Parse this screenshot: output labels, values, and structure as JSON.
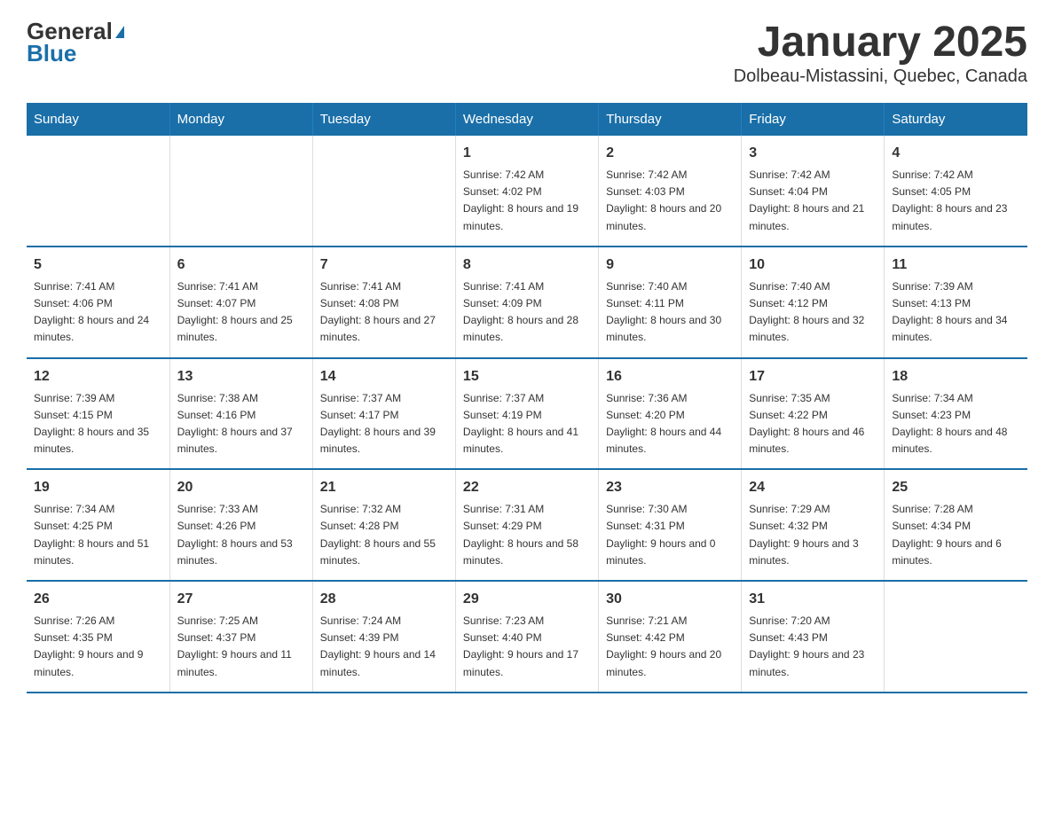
{
  "logo": {
    "general": "General",
    "blue": "Blue"
  },
  "title": "January 2025",
  "subtitle": "Dolbeau-Mistassini, Quebec, Canada",
  "headers": [
    "Sunday",
    "Monday",
    "Tuesday",
    "Wednesday",
    "Thursday",
    "Friday",
    "Saturday"
  ],
  "weeks": [
    [
      {
        "day": "",
        "sunrise": "",
        "sunset": "",
        "daylight": ""
      },
      {
        "day": "",
        "sunrise": "",
        "sunset": "",
        "daylight": ""
      },
      {
        "day": "",
        "sunrise": "",
        "sunset": "",
        "daylight": ""
      },
      {
        "day": "1",
        "sunrise": "Sunrise: 7:42 AM",
        "sunset": "Sunset: 4:02 PM",
        "daylight": "Daylight: 8 hours and 19 minutes."
      },
      {
        "day": "2",
        "sunrise": "Sunrise: 7:42 AM",
        "sunset": "Sunset: 4:03 PM",
        "daylight": "Daylight: 8 hours and 20 minutes."
      },
      {
        "day": "3",
        "sunrise": "Sunrise: 7:42 AM",
        "sunset": "Sunset: 4:04 PM",
        "daylight": "Daylight: 8 hours and 21 minutes."
      },
      {
        "day": "4",
        "sunrise": "Sunrise: 7:42 AM",
        "sunset": "Sunset: 4:05 PM",
        "daylight": "Daylight: 8 hours and 23 minutes."
      }
    ],
    [
      {
        "day": "5",
        "sunrise": "Sunrise: 7:41 AM",
        "sunset": "Sunset: 4:06 PM",
        "daylight": "Daylight: 8 hours and 24 minutes."
      },
      {
        "day": "6",
        "sunrise": "Sunrise: 7:41 AM",
        "sunset": "Sunset: 4:07 PM",
        "daylight": "Daylight: 8 hours and 25 minutes."
      },
      {
        "day": "7",
        "sunrise": "Sunrise: 7:41 AM",
        "sunset": "Sunset: 4:08 PM",
        "daylight": "Daylight: 8 hours and 27 minutes."
      },
      {
        "day": "8",
        "sunrise": "Sunrise: 7:41 AM",
        "sunset": "Sunset: 4:09 PM",
        "daylight": "Daylight: 8 hours and 28 minutes."
      },
      {
        "day": "9",
        "sunrise": "Sunrise: 7:40 AM",
        "sunset": "Sunset: 4:11 PM",
        "daylight": "Daylight: 8 hours and 30 minutes."
      },
      {
        "day": "10",
        "sunrise": "Sunrise: 7:40 AM",
        "sunset": "Sunset: 4:12 PM",
        "daylight": "Daylight: 8 hours and 32 minutes."
      },
      {
        "day": "11",
        "sunrise": "Sunrise: 7:39 AM",
        "sunset": "Sunset: 4:13 PM",
        "daylight": "Daylight: 8 hours and 34 minutes."
      }
    ],
    [
      {
        "day": "12",
        "sunrise": "Sunrise: 7:39 AM",
        "sunset": "Sunset: 4:15 PM",
        "daylight": "Daylight: 8 hours and 35 minutes."
      },
      {
        "day": "13",
        "sunrise": "Sunrise: 7:38 AM",
        "sunset": "Sunset: 4:16 PM",
        "daylight": "Daylight: 8 hours and 37 minutes."
      },
      {
        "day": "14",
        "sunrise": "Sunrise: 7:37 AM",
        "sunset": "Sunset: 4:17 PM",
        "daylight": "Daylight: 8 hours and 39 minutes."
      },
      {
        "day": "15",
        "sunrise": "Sunrise: 7:37 AM",
        "sunset": "Sunset: 4:19 PM",
        "daylight": "Daylight: 8 hours and 41 minutes."
      },
      {
        "day": "16",
        "sunrise": "Sunrise: 7:36 AM",
        "sunset": "Sunset: 4:20 PM",
        "daylight": "Daylight: 8 hours and 44 minutes."
      },
      {
        "day": "17",
        "sunrise": "Sunrise: 7:35 AM",
        "sunset": "Sunset: 4:22 PM",
        "daylight": "Daylight: 8 hours and 46 minutes."
      },
      {
        "day": "18",
        "sunrise": "Sunrise: 7:34 AM",
        "sunset": "Sunset: 4:23 PM",
        "daylight": "Daylight: 8 hours and 48 minutes."
      }
    ],
    [
      {
        "day": "19",
        "sunrise": "Sunrise: 7:34 AM",
        "sunset": "Sunset: 4:25 PM",
        "daylight": "Daylight: 8 hours and 51 minutes."
      },
      {
        "day": "20",
        "sunrise": "Sunrise: 7:33 AM",
        "sunset": "Sunset: 4:26 PM",
        "daylight": "Daylight: 8 hours and 53 minutes."
      },
      {
        "day": "21",
        "sunrise": "Sunrise: 7:32 AM",
        "sunset": "Sunset: 4:28 PM",
        "daylight": "Daylight: 8 hours and 55 minutes."
      },
      {
        "day": "22",
        "sunrise": "Sunrise: 7:31 AM",
        "sunset": "Sunset: 4:29 PM",
        "daylight": "Daylight: 8 hours and 58 minutes."
      },
      {
        "day": "23",
        "sunrise": "Sunrise: 7:30 AM",
        "sunset": "Sunset: 4:31 PM",
        "daylight": "Daylight: 9 hours and 0 minutes."
      },
      {
        "day": "24",
        "sunrise": "Sunrise: 7:29 AM",
        "sunset": "Sunset: 4:32 PM",
        "daylight": "Daylight: 9 hours and 3 minutes."
      },
      {
        "day": "25",
        "sunrise": "Sunrise: 7:28 AM",
        "sunset": "Sunset: 4:34 PM",
        "daylight": "Daylight: 9 hours and 6 minutes."
      }
    ],
    [
      {
        "day": "26",
        "sunrise": "Sunrise: 7:26 AM",
        "sunset": "Sunset: 4:35 PM",
        "daylight": "Daylight: 9 hours and 9 minutes."
      },
      {
        "day": "27",
        "sunrise": "Sunrise: 7:25 AM",
        "sunset": "Sunset: 4:37 PM",
        "daylight": "Daylight: 9 hours and 11 minutes."
      },
      {
        "day": "28",
        "sunrise": "Sunrise: 7:24 AM",
        "sunset": "Sunset: 4:39 PM",
        "daylight": "Daylight: 9 hours and 14 minutes."
      },
      {
        "day": "29",
        "sunrise": "Sunrise: 7:23 AM",
        "sunset": "Sunset: 4:40 PM",
        "daylight": "Daylight: 9 hours and 17 minutes."
      },
      {
        "day": "30",
        "sunrise": "Sunrise: 7:21 AM",
        "sunset": "Sunset: 4:42 PM",
        "daylight": "Daylight: 9 hours and 20 minutes."
      },
      {
        "day": "31",
        "sunrise": "Sunrise: 7:20 AM",
        "sunset": "Sunset: 4:43 PM",
        "daylight": "Daylight: 9 hours and 23 minutes."
      },
      {
        "day": "",
        "sunrise": "",
        "sunset": "",
        "daylight": ""
      }
    ]
  ]
}
